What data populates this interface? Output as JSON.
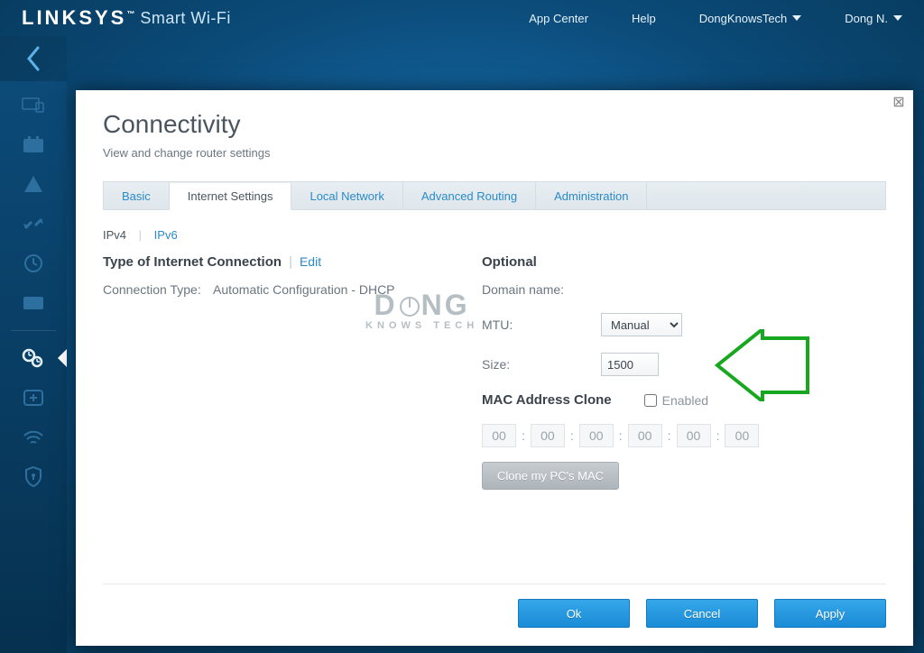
{
  "brand": {
    "logo": "LINKSYS",
    "suffix": "Smart Wi-Fi"
  },
  "header_menu": {
    "app_center": "App Center",
    "help": "Help",
    "account": "DongKnowsTech",
    "user": "Dong N."
  },
  "sidebar_icons": [
    "devices-icon",
    "calendar-icon",
    "warning-icon",
    "arrows-icon",
    "clock-icon",
    "card-icon",
    "gears-icon",
    "medical-icon",
    "wifi-icon",
    "shield-icon"
  ],
  "panel": {
    "title": "Connectivity",
    "subtitle": "View and change router settings",
    "tabs": [
      "Basic",
      "Internet Settings",
      "Local Network",
      "Advanced Routing",
      "Administration"
    ],
    "subtabs": {
      "active": "IPv4",
      "other": "IPv6"
    },
    "left": {
      "heading": "Type of Internet Connection",
      "edit": "Edit",
      "conn_label": "Connection Type:",
      "conn_value": "Automatic Configuration - DHCP"
    },
    "right": {
      "heading": "Optional",
      "domain_label": "Domain name:",
      "domain_value": "",
      "mtu_label": "MTU:",
      "mtu_value": "Manual",
      "size_label": "Size:",
      "size_value": "1500",
      "mac_heading": "MAC Address Clone",
      "enabled_label": "Enabled",
      "enabled_value": false,
      "mac_octets": [
        "00",
        "00",
        "00",
        "00",
        "00",
        "00"
      ],
      "clone_btn": "Clone my PC's MAC"
    },
    "buttons": {
      "ok": "Ok",
      "cancel": "Cancel",
      "apply": "Apply"
    }
  },
  "watermark": {
    "line1": "DONG",
    "line2": "KNOWS TECH"
  }
}
